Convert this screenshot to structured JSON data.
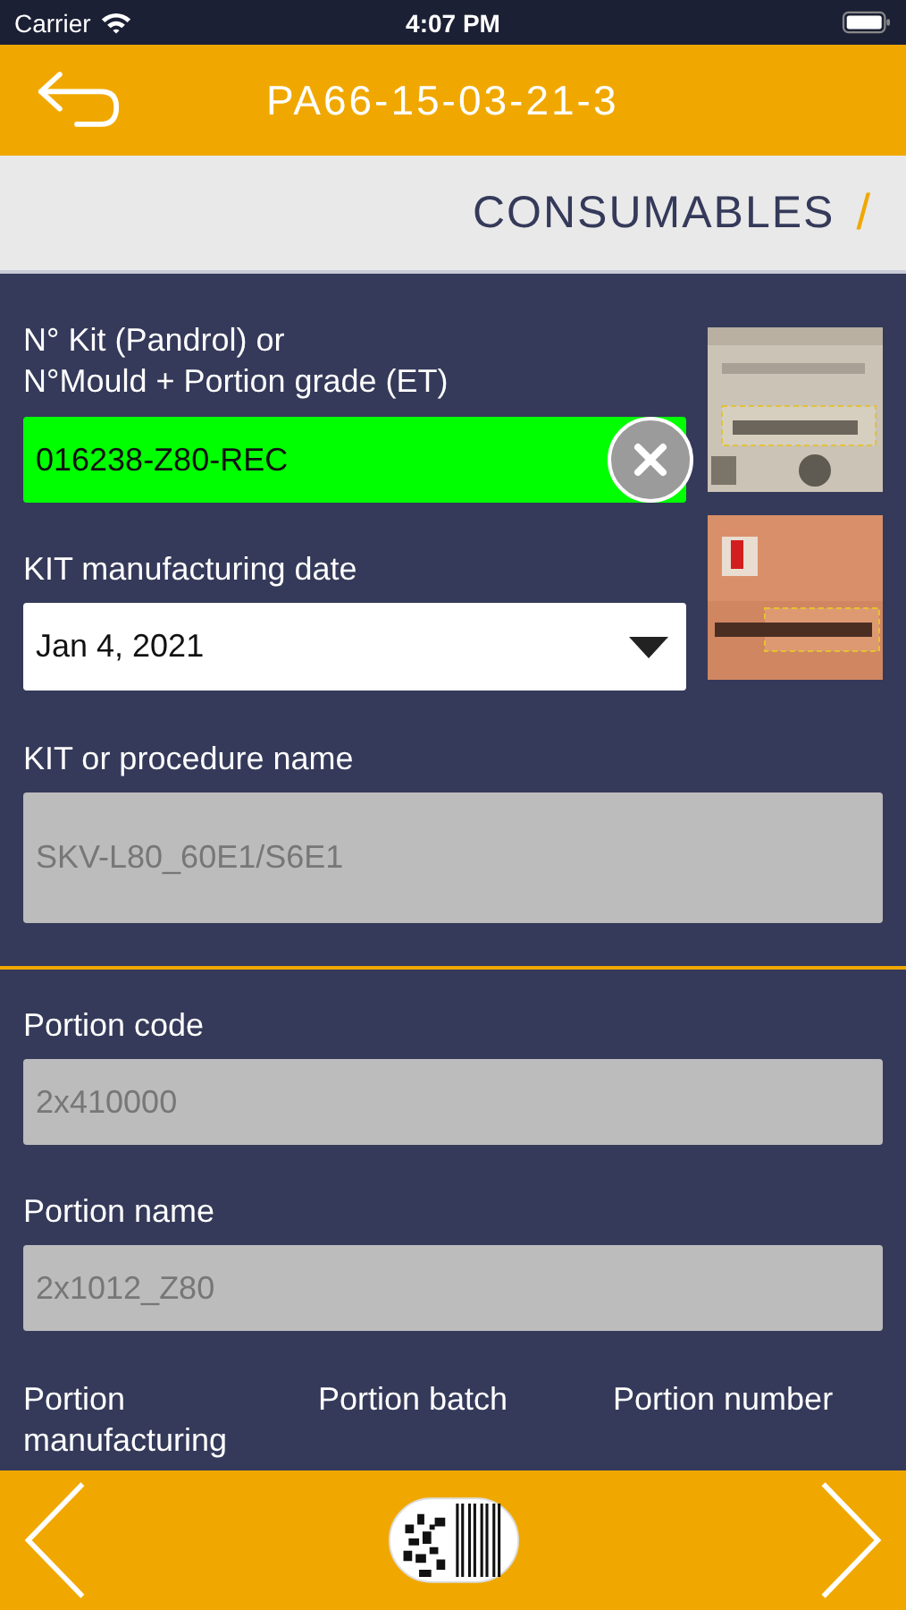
{
  "status_bar": {
    "carrier": "Carrier",
    "time": "4:07 PM"
  },
  "header": {
    "title": "PA66-15-03-21-3"
  },
  "section": {
    "title": "CONSUMABLES",
    "mark": "/"
  },
  "kit": {
    "label_lines": [
      "N° Kit (Pandrol) or",
      "N°Mould + Portion grade (ET)"
    ],
    "value": "016238-Z80-REC",
    "valid": true
  },
  "kit_date": {
    "label": "KIT manufacturing date",
    "value": "Jan 4, 2021"
  },
  "procedure": {
    "label": "KIT or procedure name",
    "value": "SKV-L80_60E1/S6E1",
    "disabled": true
  },
  "portion_fields": [
    {
      "label": "Portion code",
      "value": "2x410000",
      "disabled": true
    },
    {
      "label": "Portion name",
      "value": "2x1012_Z80",
      "disabled": true
    }
  ],
  "portion_columns": [
    "Portion manufacturing",
    "Portion batch",
    "Portion number"
  ]
}
